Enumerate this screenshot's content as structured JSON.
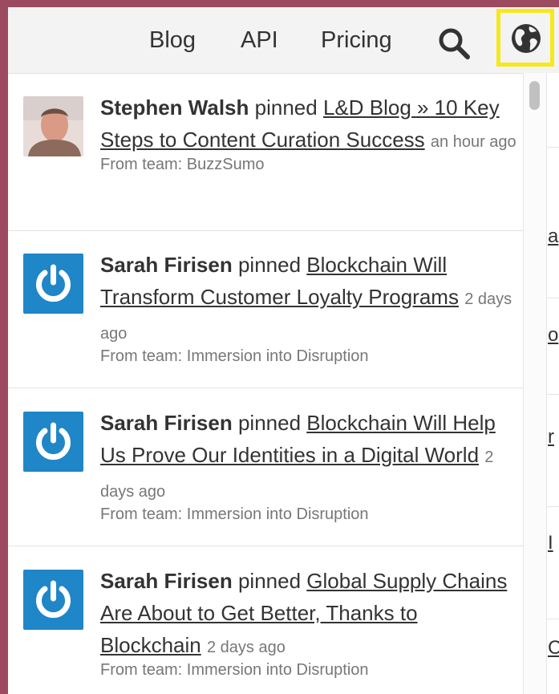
{
  "nav": {
    "links": [
      "Blog",
      "API",
      "Pricing"
    ],
    "search_icon": "search-icon",
    "globe_icon": "globe-icon",
    "highlight_color": "#f6e81c"
  },
  "feed": [
    {
      "avatar": "user-photo",
      "user": "Stephen Walsh",
      "action": "pinned",
      "title": "L&D Blog » 10 Key Steps to Content Curation Success",
      "time": "an hour ago",
      "team": "From team: BuzzSumo"
    },
    {
      "avatar": "power-logo",
      "user": "Sarah Firisen",
      "action": "pinned",
      "title": "Blockchain Will Transform Customer Loyalty Programs",
      "time": "2 days ago",
      "team": "From team: Immersion into Disruption"
    },
    {
      "avatar": "power-logo",
      "user": "Sarah Firisen",
      "action": "pinned",
      "title": "Blockchain Will Help Us Prove Our Identities in a Digital World",
      "time": "2 days ago",
      "team": "From team: Immersion into Disruption"
    },
    {
      "avatar": "power-logo",
      "user": "Sarah Firisen",
      "action": "pinned",
      "title": "Global Supply Chains Are About to Get Better, Thanks to Blockchain",
      "time": "2 days ago",
      "team": "From team: Immersion into Disruption"
    }
  ],
  "right_strip": [
    "a",
    "o",
    "r",
    "I",
    "C"
  ],
  "colors": {
    "frame": "#9c4a5f",
    "avatar_blue": "#1f86c8"
  }
}
